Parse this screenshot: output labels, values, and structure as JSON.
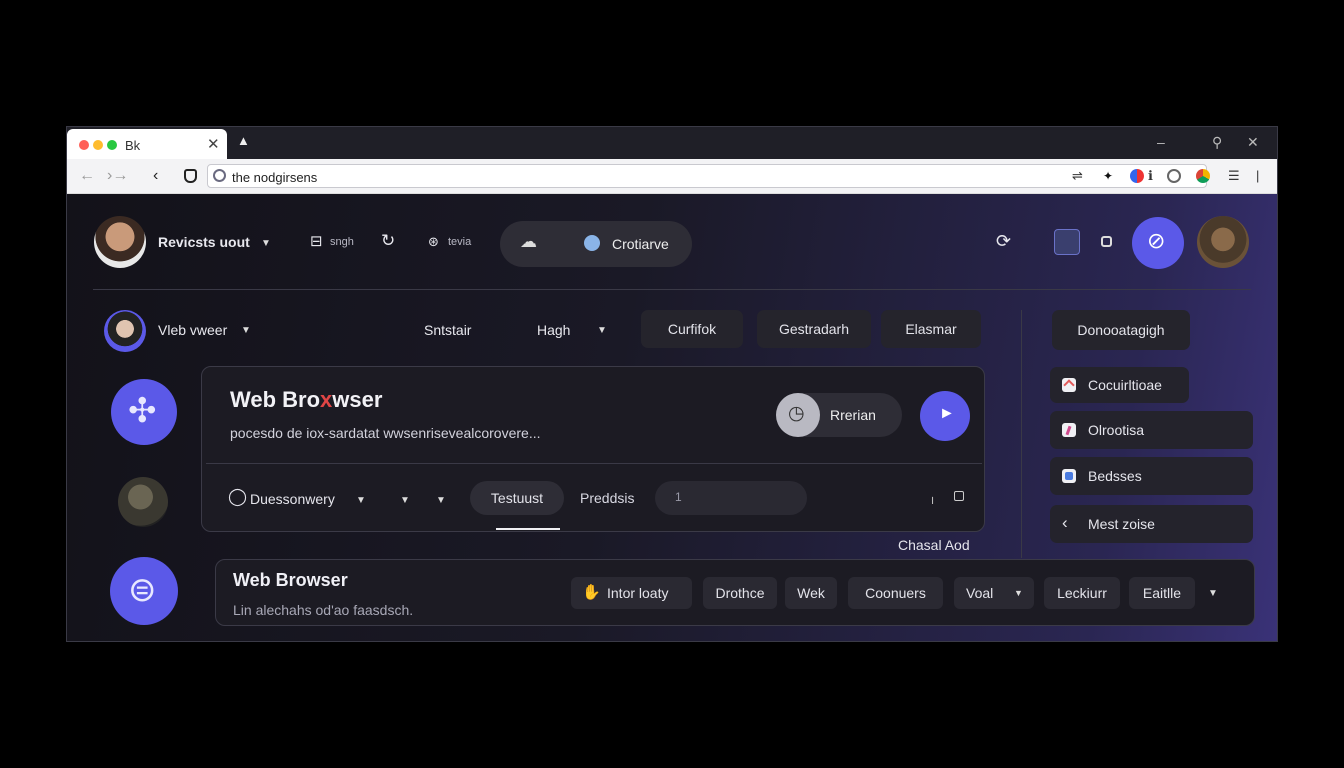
{
  "window": {
    "tab_title": "Bk",
    "tab_close": "✕",
    "new_tab": "▲",
    "address": "the nodgirsens",
    "min": "–",
    "search": "⚲",
    "close": "✕"
  },
  "colors": {
    "accent": "#5b59e8",
    "traffic_red": "#ff5f57",
    "traffic_yellow": "#febc2e",
    "traffic_green": "#28c840"
  },
  "header": {
    "profile_name": "Revicsts uout",
    "item1": "sngh",
    "item3": "tevia",
    "pill_label": "Crotiarve"
  },
  "subheader": {
    "profile_name": "Vleb vweer",
    "tab1": "Sntstair",
    "tab2": "Hagh",
    "btn1": "Curfifok",
    "btn2": "Gestradarh",
    "btn3": "Elasmar",
    "btn4": "Donooatagigh"
  },
  "main_card": {
    "title_a": "Web Bro",
    "title_x": "x",
    "title_b": "wser",
    "subtitle": "pocesdo de iox-sardatat wwsenrisevealcorovere...",
    "action_label": "Rrerian",
    "toolbar_dropdown": "Duessonwery",
    "tab_active": "Testuust",
    "tab_other": "Preddsis",
    "input_value": "1",
    "corner_label": "Chasal Aod"
  },
  "sidebar": {
    "items": [
      {
        "label": "Cocuirltioae",
        "icon_color": "#e25b5b"
      },
      {
        "label": "Olrootisa",
        "icon_color": "#d04a8e"
      },
      {
        "label": "Bedsses",
        "icon_color": "#4a7be0"
      },
      {
        "label": "Mest zoise",
        "icon_color": ""
      }
    ]
  },
  "bottom_card": {
    "title": "Web Browser",
    "subtitle": "Lin alechahs od'ao faasdsch.",
    "chips": [
      "Intor loaty",
      "Drothce",
      "Wek",
      "Coonuers",
      "Voal",
      "Leckiurr",
      "Eaitlle"
    ]
  }
}
